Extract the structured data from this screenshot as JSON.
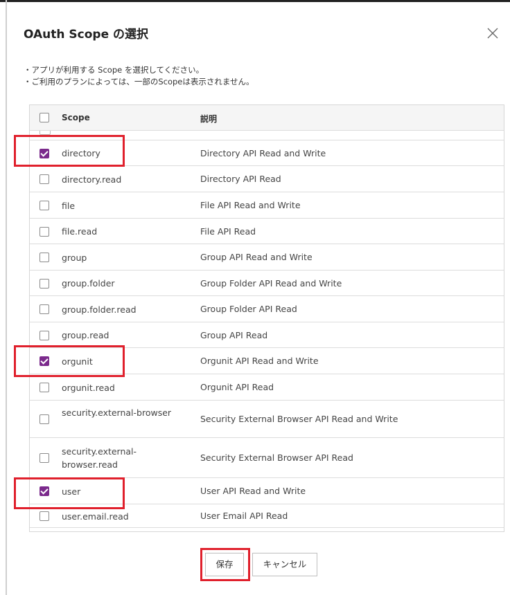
{
  "dialog": {
    "title": "OAuth Scope の選択",
    "notes": [
      "・アプリが利用する Scope を選択してください。",
      "・ご利用のプランによっては、一部のScopeは表示されません。"
    ]
  },
  "table": {
    "headers": {
      "scope": "Scope",
      "description": "説明"
    },
    "header_checkbox_checked": false,
    "rows": [
      {
        "scope": "directory",
        "description": "Directory API Read and Write",
        "checked": true
      },
      {
        "scope": "directory.read",
        "description": "Directory API Read",
        "checked": false
      },
      {
        "scope": "file",
        "description": "File API Read and Write",
        "checked": false
      },
      {
        "scope": "file.read",
        "description": "File API Read",
        "checked": false
      },
      {
        "scope": "group",
        "description": "Group API Read and Write",
        "checked": false
      },
      {
        "scope": "group.folder",
        "description": "Group Folder API Read and Write",
        "checked": false
      },
      {
        "scope": "group.folder.read",
        "description": "Group Folder API Read",
        "checked": false
      },
      {
        "scope": "group.read",
        "description": "Group API Read",
        "checked": false
      },
      {
        "scope": "orgunit",
        "description": "Orgunit API Read and Write",
        "checked": true
      },
      {
        "scope": "orgunit.read",
        "description": "Orgunit API Read",
        "checked": false
      },
      {
        "scope": "security.external-browser",
        "description": "Security External Browser API Read and Write",
        "checked": false
      },
      {
        "scope": "security.external-browser.read",
        "description": "Security External Browser API Read",
        "checked": false
      },
      {
        "scope": "user",
        "description": "User API Read and Write",
        "checked": true
      },
      {
        "scope": "user.email.read",
        "description": "User Email API Read",
        "checked": false
      }
    ]
  },
  "buttons": {
    "save": "保存",
    "cancel": "キャンセル"
  },
  "colors": {
    "checked": "#7b2a8c",
    "highlight": "#e0202c"
  },
  "icons": {
    "close": "close-icon",
    "check": "check-icon"
  }
}
